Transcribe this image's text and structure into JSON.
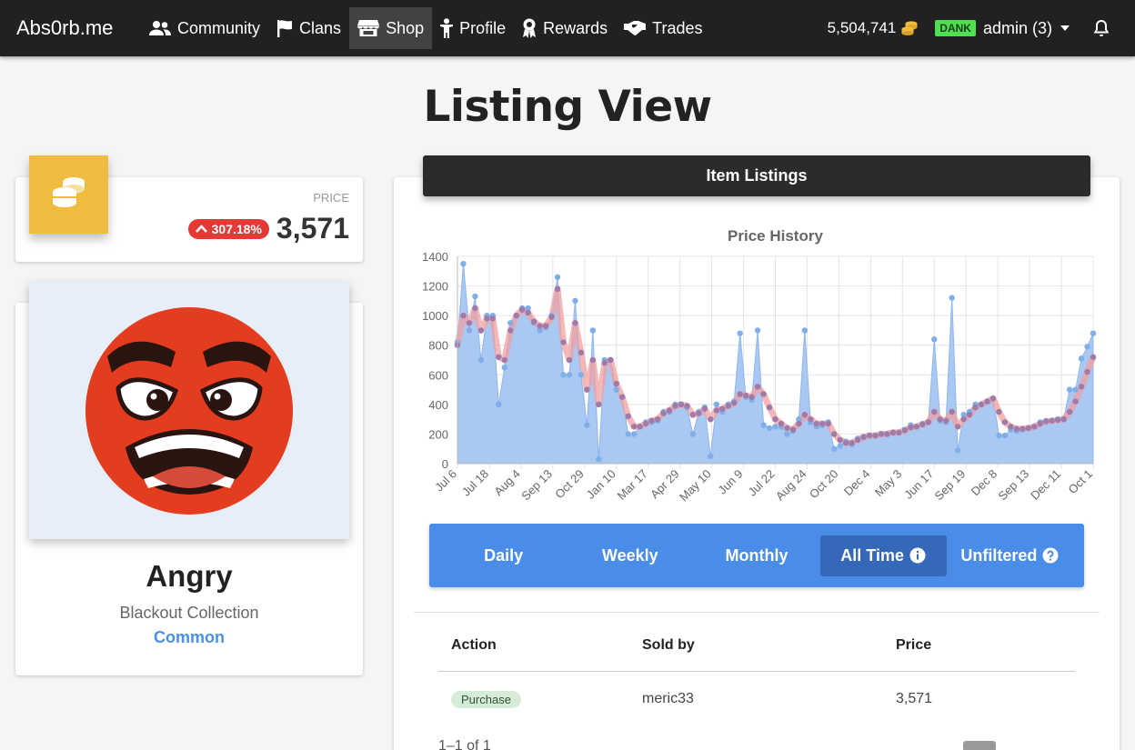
{
  "nav": {
    "brand": "Abs0rb.me",
    "items": [
      {
        "label": "Community",
        "icon": "users-icon"
      },
      {
        "label": "Clans",
        "icon": "flag-icon"
      },
      {
        "label": "Shop",
        "icon": "store-icon"
      },
      {
        "label": "Profile",
        "icon": "person-icon"
      },
      {
        "label": "Rewards",
        "icon": "award-icon"
      },
      {
        "label": "Trades",
        "icon": "handshake-icon"
      }
    ],
    "active": "Shop",
    "balance": "5,504,741",
    "badge": "DANK",
    "user": "admin (3)"
  },
  "page": {
    "title": "Listing View"
  },
  "price_card": {
    "label": "PRICE",
    "change": "307.18%",
    "value": "3,571"
  },
  "item": {
    "name": "Angry",
    "collection": "Blackout Collection",
    "rarity": "Common"
  },
  "listings": {
    "header": "Item Listings"
  },
  "ranges": [
    {
      "label": "Daily",
      "icon": ""
    },
    {
      "label": "Weekly",
      "icon": ""
    },
    {
      "label": "Monthly",
      "icon": ""
    },
    {
      "label": "All Time",
      "icon": "info-icon"
    },
    {
      "label": "Unfiltered",
      "icon": "question-icon"
    }
  ],
  "active_range": "All Time",
  "table": {
    "headers": [
      "Action",
      "Sold by",
      "Price"
    ],
    "rows": [
      {
        "action": "Purchase",
        "seller": "meric33",
        "price": "3,571"
      }
    ],
    "pager": "1–1 of 1"
  },
  "colors": {
    "accent": "#4a8de8",
    "navbar": "#212121",
    "coin": "#f0bc40",
    "badge_red": "#e53935",
    "area_fill": "#a9c8f2",
    "avg_line": "#f2a0a0"
  },
  "chart_data": {
    "type": "area",
    "title": "Price History",
    "xlabel": "",
    "ylabel": "",
    "ylim": [
      0,
      1400
    ],
    "yticks": [
      0,
      200,
      400,
      600,
      800,
      1000,
      1200,
      1400
    ],
    "xticks": [
      "Jul 6",
      "Jul 18",
      "Aug 4",
      "Sep 13",
      "Oct 29",
      "Jan 10",
      "Mar 17",
      "Apr 29",
      "May 10",
      "Jun 9",
      "Jul 22",
      "Aug 24",
      "Oct 20",
      "Dec 4",
      "May 3",
      "Jun 17",
      "Sep 19",
      "Dec 8",
      "Sep 13",
      "Dec 11",
      "Oct 1"
    ],
    "grid": true,
    "series": [
      {
        "values": [
          820,
          1350,
          900,
          1130,
          700,
          1000,
          1000,
          400,
          650,
          950,
          1000,
          1050,
          1050,
          950,
          900,
          920,
          1000,
          1260,
          600,
          600,
          1100,
          600,
          260,
          900,
          30,
          700,
          700,
          500,
          450,
          200,
          200,
          250,
          280,
          280,
          290,
          350,
          350,
          400,
          400,
          380,
          200,
          350,
          380,
          50,
          400,
          350,
          400,
          420,
          880,
          450,
          430,
          900,
          260,
          240,
          250,
          250,
          200,
          220,
          300,
          900,
          280,
          250,
          260,
          280,
          100,
          120,
          150,
          130,
          170,
          180,
          190,
          190,
          200,
          200,
          210,
          210,
          230,
          260,
          250,
          270,
          280,
          840,
          290,
          280,
          1120,
          90,
          330,
          350,
          400,
          400,
          420,
          440,
          190,
          190,
          230,
          220,
          230,
          240,
          250,
          280,
          290,
          290,
          300,
          300,
          500,
          500,
          710,
          790,
          880
        ]
      },
      {
        "values": [
          800,
          1000,
          950,
          1050,
          900,
          980,
          980,
          720,
          700,
          900,
          1000,
          1040,
          1020,
          960,
          930,
          930,
          990,
          1180,
          820,
          700,
          950,
          750,
          500,
          700,
          400,
          680,
          700,
          540,
          450,
          320,
          250,
          250,
          270,
          290,
          300,
          340,
          360,
          390,
          400,
          390,
          330,
          340,
          370,
          300,
          360,
          370,
          390,
          410,
          470,
          460,
          450,
          520,
          470,
          380,
          300,
          270,
          240,
          230,
          270,
          330,
          300,
          270,
          270,
          270,
          200,
          160,
          140,
          140,
          160,
          180,
          190,
          190,
          200,
          200,
          210,
          210,
          225,
          245,
          250,
          265,
          280,
          350,
          300,
          290,
          350,
          250,
          300,
          330,
          380,
          400,
          420,
          440,
          350,
          280,
          250,
          235,
          235,
          240,
          250,
          270,
          285,
          290,
          295,
          300,
          350,
          420,
          520,
          620,
          720
        ]
      }
    ]
  }
}
